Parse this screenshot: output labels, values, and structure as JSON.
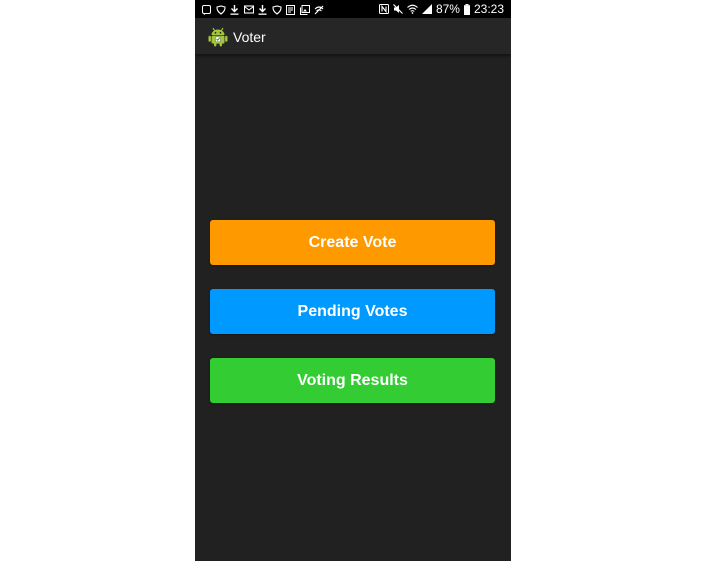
{
  "status_bar": {
    "left_icons": [
      "notification-icon",
      "shield-icon",
      "download-icon",
      "mail-icon",
      "download-icon",
      "shield-icon",
      "document-icon",
      "gallery-icon",
      "no-wifi-icon"
    ],
    "right_icons": [
      "nfc-icon",
      "mute-icon",
      "wifi-icon",
      "signal-icon"
    ],
    "battery": "87%",
    "time": "23:23"
  },
  "app_bar": {
    "title": "Voter",
    "icon": "android-icon"
  },
  "buttons": {
    "create_vote": "Create Vote",
    "pending_votes": "Pending Votes",
    "voting_results": "Voting Results"
  },
  "colors": {
    "create_vote": "#ff9900",
    "pending_votes": "#0099ff",
    "voting_results": "#33cc33",
    "background": "#212121",
    "app_bar": "#262626"
  }
}
